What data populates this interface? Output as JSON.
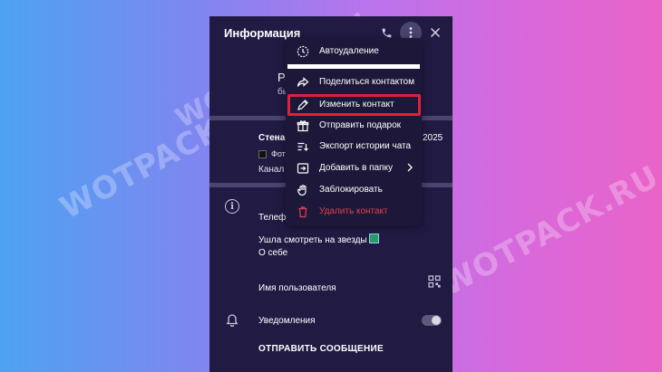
{
  "watermark": "WOTPACK.RU",
  "colors": {
    "accent_highlight": "#e0213a",
    "danger": "#e0404e",
    "panel_bg": "#211b44"
  },
  "header": {
    "title": "Информация",
    "icons": [
      "phone-icon",
      "more-vertical-icon",
      "close-icon"
    ]
  },
  "profile": {
    "name_fragment": "Ра",
    "status_fragment": "бы"
  },
  "wall": {
    "title_fragment": "Стена",
    "date_fragment": "2025",
    "photo_fragment": "Фот",
    "channel_fragment": "Канал"
  },
  "info": {
    "phone_label_fragment": "Телефо",
    "bio_text": "Ушла смотреть на звезды",
    "bio_label": "О себе",
    "username_label": "Имя пользователя",
    "notifications_label": "Уведомления",
    "notifications_enabled": true,
    "send_message": "ОТПРАВИТЬ СООБЩЕНИЕ"
  },
  "menu": {
    "items": [
      {
        "label": "Автоудаление",
        "icon": "timer-icon"
      },
      {
        "label": "Поделиться контактом",
        "icon": "share-icon"
      },
      {
        "label": "Изменить контакт",
        "icon": "pencil-icon",
        "highlighted": true
      },
      {
        "label": "Отправить подарок",
        "icon": "gift-icon"
      },
      {
        "label": "Экспорт истории чата",
        "icon": "export-icon"
      },
      {
        "label": "Добавить в папку",
        "icon": "folder-add-icon",
        "has_submenu": true
      },
      {
        "label": "Заблокировать",
        "icon": "block-icon"
      },
      {
        "label": "Удалить контакт",
        "icon": "trash-icon",
        "danger": true
      }
    ]
  }
}
